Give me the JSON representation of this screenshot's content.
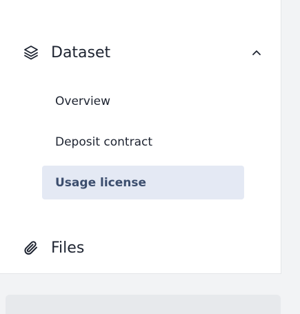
{
  "sidebar": {
    "dataset": {
      "title": "Dataset",
      "icon": "layers-icon",
      "expanded": true,
      "items": [
        {
          "label": "Overview",
          "active": false
        },
        {
          "label": "Deposit contract",
          "active": false
        },
        {
          "label": "Usage license",
          "active": true
        }
      ]
    },
    "files": {
      "title": "Files",
      "icon": "paperclip-icon"
    }
  },
  "colors": {
    "text": "#1d2330",
    "active_bg": "#e4e9f4",
    "active_text": "#3c4e6e",
    "page_bg": "#f2f3f5"
  }
}
